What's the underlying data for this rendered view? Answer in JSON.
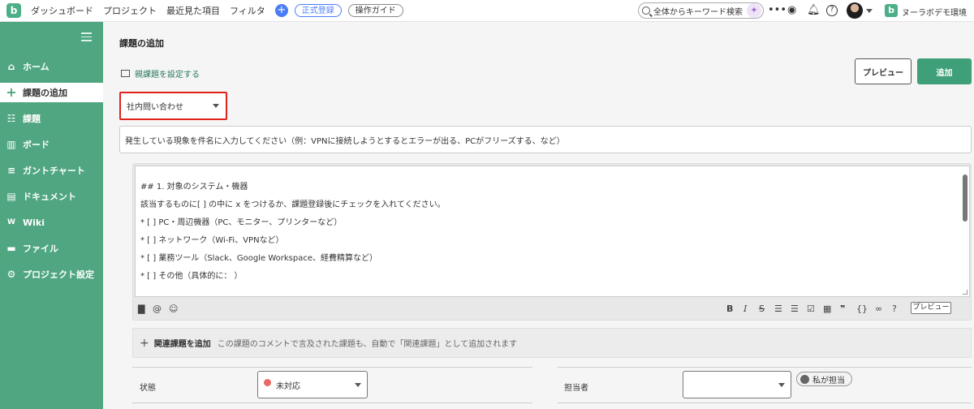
{
  "topbar": {
    "logo": "b",
    "nav": [
      "ダッシュボード",
      "プロジェクト",
      "最近見た項目",
      "フィルタ"
    ],
    "plus_icon": "plus-icon",
    "register_label": "正式登録",
    "guide_label": "操作ガイド",
    "search_placeholder": "全体からキーワード検索",
    "space_logo": "b",
    "space_name": "ヌーラボデモ環境"
  },
  "sidebar": {
    "items": [
      {
        "label": "ホーム",
        "icon": "home-icon"
      },
      {
        "label": "課題の追加",
        "icon": "plus-icon",
        "active": true
      },
      {
        "label": "課題",
        "icon": "list-icon"
      },
      {
        "label": "ボード",
        "icon": "board-icon"
      },
      {
        "label": "ガントチャート",
        "icon": "gantt-icon"
      },
      {
        "label": "ドキュメント",
        "icon": "document-icon"
      },
      {
        "label": "Wiki",
        "icon": "wiki-icon"
      },
      {
        "label": "ファイル",
        "icon": "folder-icon"
      },
      {
        "label": "プロジェクト設定",
        "icon": "gear-icon"
      }
    ]
  },
  "main": {
    "title": "課題の追加",
    "parent_link": "親課題を設定する",
    "preview_button": "プレビュー",
    "add_button": "追加",
    "issue_type": "社内問い合わせ",
    "subject_placeholder": "発生している現象を件名に入力してください（例：VPNに接続しようとするとエラーが出る、PCがフリーズする、など）",
    "editor_lines": [
      "## 1. 対象のシステム・機器",
      "該当するものに[ ] の中に x をつけるか、課題登録後にチェックを入れてください。",
      "*  [ ] PC・周辺機器（PC、モニター、プリンターなど）",
      "*  [ ] ネットワーク（Wi-Fi、VPNなど）",
      "*  [ ] 業務ツール（Slack、Google Workspace、経費精算など）",
      "*  [ ] その他（具体的に：                              ）"
    ],
    "toolbar_preview": "プレビュー",
    "related_label": "関連課題を追加",
    "related_desc": "この課題のコメントで言及された課題も、自動で「関連課題」として追加されます",
    "status_label": "状態",
    "status_value": "未対応",
    "status_color": "#e86a62",
    "assignee_label": "担当者",
    "assign_me": "私が担当"
  }
}
